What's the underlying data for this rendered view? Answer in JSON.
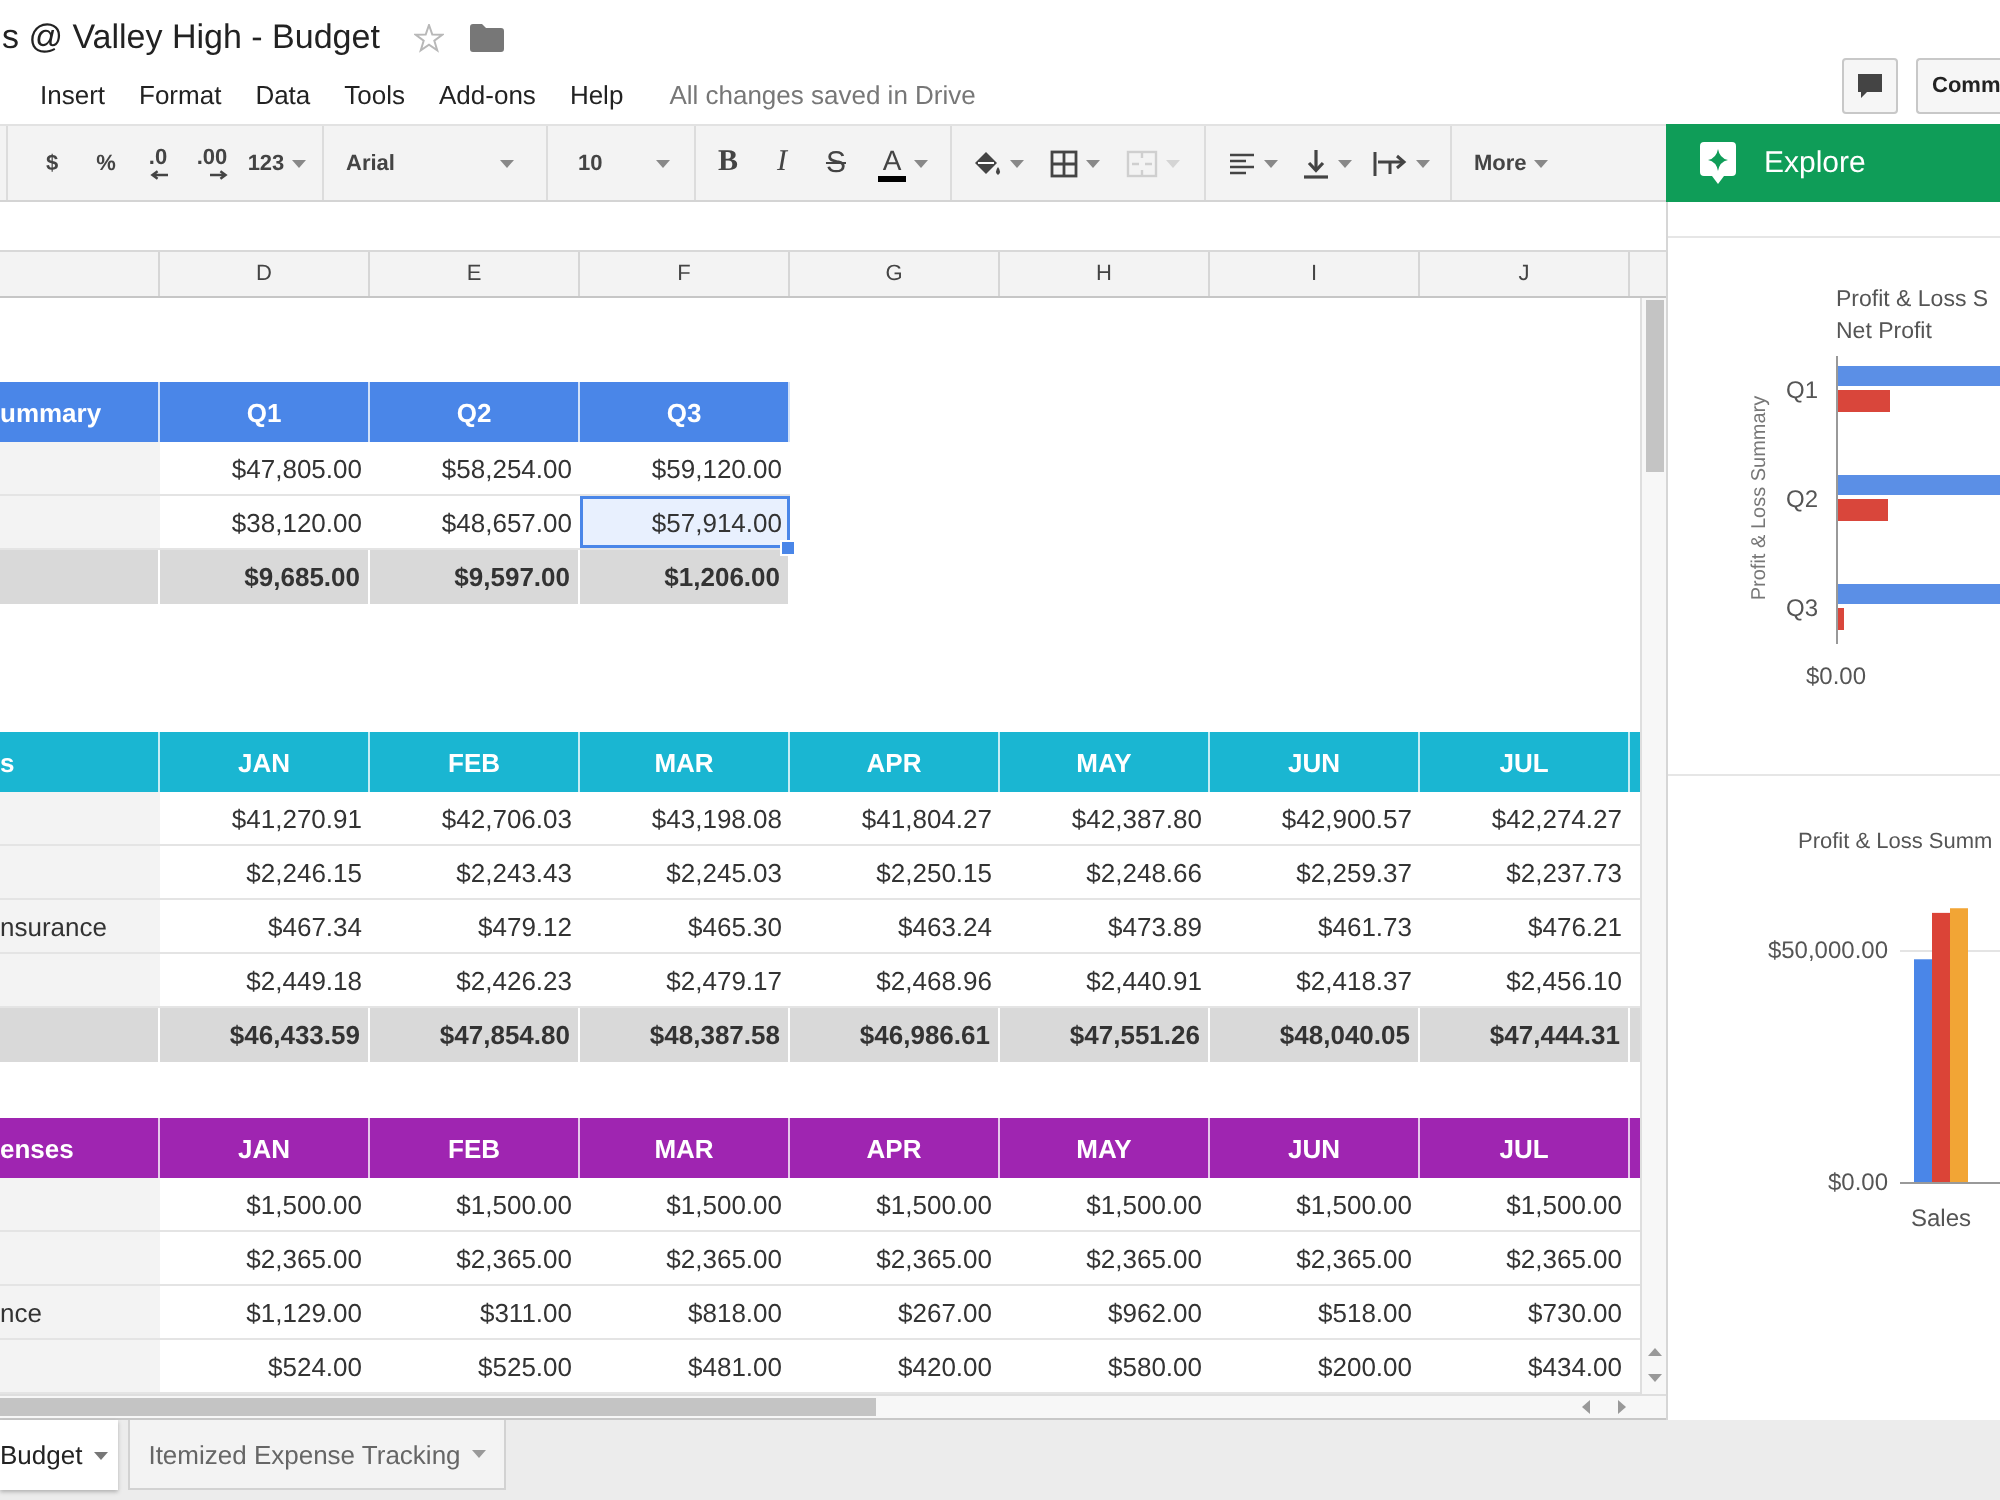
{
  "document": {
    "title": "s @ Valley High - Budget",
    "starred": false
  },
  "menu": [
    "Insert",
    "Format",
    "Data",
    "Tools",
    "Add-ons",
    "Help"
  ],
  "save_status": "All changes saved in Drive",
  "comments_button": {
    "label": "Comm"
  },
  "toolbar": {
    "currency": "$",
    "percent": "%",
    "fewer_decimals": ".0",
    "more_decimals": ".00",
    "number_format": "123",
    "font": "Arial",
    "font_size": "10",
    "bold": "B",
    "italic": "I",
    "strikethrough": "S",
    "text_color": "A",
    "merge_disabled": true,
    "more": "More"
  },
  "sheet": {
    "columns": [
      "D",
      "E",
      "F",
      "G",
      "H",
      "I",
      "J"
    ],
    "tables": [
      {
        "color": "#4a86e8",
        "header": [
          "ummary",
          "Q1",
          "Q2",
          "Q3"
        ],
        "rows": [
          {
            "kind": "data",
            "cells": [
              {
                "text": "$47,805.00",
                "selected": false
              },
              {
                "text": "$58,254.00",
                "selected": false
              },
              {
                "text": "$59,120.00",
                "selected": false
              }
            ]
          },
          {
            "kind": "data",
            "cells": [
              {
                "text": "$38,120.00",
                "selected": false
              },
              {
                "text": "$48,657.00",
                "selected": false
              },
              {
                "text": "$57,914.00",
                "selected": true
              }
            ]
          },
          {
            "kind": "total",
            "cells": [
              {
                "text": "$9,685.00",
                "selected": false
              },
              {
                "text": "$9,597.00",
                "selected": false
              },
              {
                "text": "$1,206.00",
                "selected": false
              }
            ]
          }
        ]
      },
      {
        "color": "#1ab6d2",
        "header": [
          "s",
          "JAN",
          "FEB",
          "MAR",
          "APR",
          "MAY",
          "JUN",
          "JUL"
        ],
        "rows": [
          {
            "kind": "data",
            "cells": [
              {
                "text": "$41,270.91",
                "selected": false
              },
              {
                "text": "$42,706.03",
                "selected": false
              },
              {
                "text": "$43,198.08",
                "selected": false
              },
              {
                "text": "$41,804.27",
                "selected": false
              },
              {
                "text": "$42,387.80",
                "selected": false
              },
              {
                "text": "$42,900.57",
                "selected": false
              },
              {
                "text": "$42,274.27",
                "selected": false
              }
            ]
          },
          {
            "kind": "data",
            "cells": [
              {
                "text": "$2,246.15",
                "selected": false
              },
              {
                "text": "$2,243.43",
                "selected": false
              },
              {
                "text": "$2,245.03",
                "selected": false
              },
              {
                "text": "$2,250.15",
                "selected": false
              },
              {
                "text": "$2,248.66",
                "selected": false
              },
              {
                "text": "$2,259.37",
                "selected": false
              },
              {
                "text": "$2,237.73",
                "selected": false
              }
            ]
          },
          {
            "kind": "data",
            "label": "nsurance",
            "cells": [
              {
                "text": "$467.34",
                "selected": false
              },
              {
                "text": "$479.12",
                "selected": false
              },
              {
                "text": "$465.30",
                "selected": false
              },
              {
                "text": "$463.24",
                "selected": false
              },
              {
                "text": "$473.89",
                "selected": false
              },
              {
                "text": "$461.73",
                "selected": false
              },
              {
                "text": "$476.21",
                "selected": false
              }
            ]
          },
          {
            "kind": "data",
            "cells": [
              {
                "text": "$2,449.18",
                "selected": false
              },
              {
                "text": "$2,426.23",
                "selected": false
              },
              {
                "text": "$2,479.17",
                "selected": false
              },
              {
                "text": "$2,468.96",
                "selected": false
              },
              {
                "text": "$2,440.91",
                "selected": false
              },
              {
                "text": "$2,418.37",
                "selected": false
              },
              {
                "text": "$2,456.10",
                "selected": false
              }
            ]
          },
          {
            "kind": "total",
            "cells": [
              {
                "text": "$46,433.59",
                "selected": false
              },
              {
                "text": "$47,854.80",
                "selected": false
              },
              {
                "text": "$48,387.58",
                "selected": false
              },
              {
                "text": "$46,986.61",
                "selected": false
              },
              {
                "text": "$47,551.26",
                "selected": false
              },
              {
                "text": "$48,040.05",
                "selected": false
              },
              {
                "text": "$47,444.31",
                "selected": false
              }
            ]
          }
        ]
      },
      {
        "color": "#9f25b1",
        "header": [
          "enses",
          "JAN",
          "FEB",
          "MAR",
          "APR",
          "MAY",
          "JUN",
          "JUL"
        ],
        "rows": [
          {
            "kind": "data",
            "cells": [
              {
                "text": "$1,500.00",
                "selected": false
              },
              {
                "text": "$1,500.00",
                "selected": false
              },
              {
                "text": "$1,500.00",
                "selected": false
              },
              {
                "text": "$1,500.00",
                "selected": false
              },
              {
                "text": "$1,500.00",
                "selected": false
              },
              {
                "text": "$1,500.00",
                "selected": false
              },
              {
                "text": "$1,500.00",
                "selected": false
              }
            ]
          },
          {
            "kind": "data",
            "cells": [
              {
                "text": "$2,365.00",
                "selected": false
              },
              {
                "text": "$2,365.00",
                "selected": false
              },
              {
                "text": "$2,365.00",
                "selected": false
              },
              {
                "text": "$2,365.00",
                "selected": false
              },
              {
                "text": "$2,365.00",
                "selected": false
              },
              {
                "text": "$2,365.00",
                "selected": false
              },
              {
                "text": "$2,365.00",
                "selected": false
              }
            ]
          },
          {
            "kind": "data",
            "label": "nce",
            "cells": [
              {
                "text": "$1,129.00",
                "selected": false
              },
              {
                "text": "$311.00",
                "selected": false
              },
              {
                "text": "$818.00",
                "selected": false
              },
              {
                "text": "$267.00",
                "selected": false
              },
              {
                "text": "$962.00",
                "selected": false
              },
              {
                "text": "$518.00",
                "selected": false
              },
              {
                "text": "$730.00",
                "selected": false
              }
            ]
          },
          {
            "kind": "data",
            "cells": [
              {
                "text": "$524.00",
                "selected": false
              },
              {
                "text": "$525.00",
                "selected": false
              },
              {
                "text": "$481.00",
                "selected": false
              },
              {
                "text": "$420.00",
                "selected": false
              },
              {
                "text": "$580.00",
                "selected": false
              },
              {
                "text": "$200.00",
                "selected": false
              },
              {
                "text": "$434.00",
                "selected": false
              }
            ]
          }
        ]
      }
    ]
  },
  "explore": {
    "label": "Explore",
    "net_profit_chart": {
      "title": "Profit & Loss S",
      "subtitle": "Net Profit",
      "axis_label": "Profit & Loss Summary",
      "categories": [
        "Q1",
        "Q2",
        "Q3"
      ],
      "tick": "$0.00"
    },
    "summary_chart": {
      "chart_data": {
        "type": "bar",
        "title": "Profit & Loss Summ",
        "categories": [
          "Sales"
        ],
        "series": [
          {
            "color": "#4a86e8",
            "values": [
              48000
            ]
          },
          {
            "color": "#db4437",
            "values": [
              58000
            ]
          },
          {
            "color": "#f2a535",
            "values": [
              59000
            ]
          }
        ],
        "ylim": [
          0,
          60000
        ],
        "yticks": [
          {
            "value": 0,
            "label": "$0.00"
          },
          {
            "value": 50000,
            "label": "$50,000.00"
          }
        ]
      }
    }
  },
  "sheet_tabs": [
    {
      "label": "Budget",
      "selected": true
    },
    {
      "label": "Itemized Expense Tracking",
      "selected": false
    }
  ]
}
